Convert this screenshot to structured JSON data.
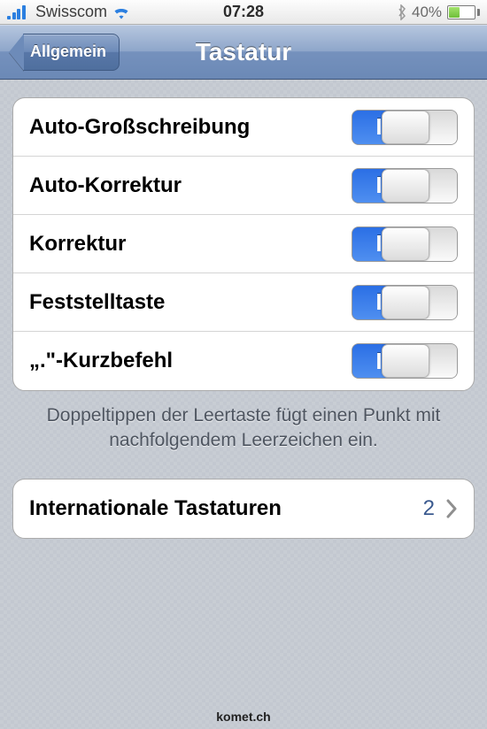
{
  "status": {
    "carrier": "Swisscom",
    "time": "07:28",
    "battery_pct": "40%"
  },
  "nav": {
    "back_label": "Allgemein",
    "title": "Tastatur"
  },
  "settings": [
    {
      "label": "Auto-Großschreibung",
      "on_label": "I",
      "state": true
    },
    {
      "label": "Auto-Korrektur",
      "on_label": "I",
      "state": true
    },
    {
      "label": "Korrektur",
      "on_label": "I",
      "state": true
    },
    {
      "label": "Feststelltaste",
      "on_label": "I",
      "state": true
    },
    {
      "label": "„.\"-Kurzbefehl",
      "on_label": "I",
      "state": true
    }
  ],
  "footer_note": "Doppeltippen der Leertaste fügt einen Punkt mit nachfolgendem Leerzeichen ein.",
  "intl": {
    "label": "Internationale Tastaturen",
    "count": "2"
  },
  "watermark": "komet.ch"
}
